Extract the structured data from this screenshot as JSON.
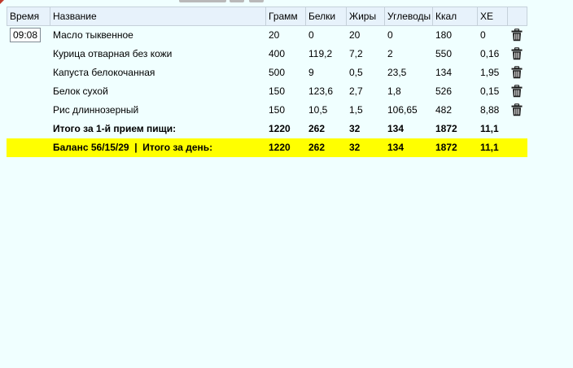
{
  "columns": {
    "time": "Время",
    "name": "Название",
    "grams": "Грамм",
    "protein": "Белки",
    "fat": "Жиры",
    "carbs": "Углеводы",
    "kcal": "Ккал",
    "xe": "ХЕ"
  },
  "rows": [
    {
      "time": "09:08",
      "name": "Масло тыквенное",
      "grams": "20",
      "protein": "0",
      "fat": "20",
      "carbs": "0",
      "kcal": "180",
      "xe": "0",
      "icon": "trash-icon"
    },
    {
      "time": "",
      "name": "Курица отварная без кожи",
      "grams": "400",
      "protein": "119,2",
      "fat": "7,2",
      "carbs": "2",
      "kcal": "550",
      "xe": "0,16",
      "icon": "trash-icon"
    },
    {
      "time": "",
      "name": "Капуста белокочанная",
      "grams": "500",
      "protein": "9",
      "fat": "0,5",
      "carbs": "23,5",
      "kcal": "134",
      "xe": "1,95",
      "icon": "trash-icon"
    },
    {
      "time": "",
      "name": "Белок сухой",
      "grams": "150",
      "protein": "123,6",
      "fat": "2,7",
      "carbs": "1,8",
      "kcal": "526",
      "xe": "0,15",
      "icon": "trash-icon"
    },
    {
      "time": "",
      "name": "Рис длиннозерный",
      "grams": "150",
      "protein": "10,5",
      "fat": "1,5",
      "carbs": "106,65",
      "kcal": "482",
      "xe": "8,88",
      "icon": "trash-icon"
    }
  ],
  "subtotal": {
    "label": "Итого за 1-й прием пищи:",
    "grams": "1220",
    "protein": "262",
    "fat": "32",
    "carbs": "134",
    "kcal": "1872",
    "xe": "11,1"
  },
  "total": {
    "label": "Баланс 56/15/29  |  Итого за день:",
    "grams": "1220",
    "protein": "262",
    "fat": "32",
    "carbs": "134",
    "kcal": "1872",
    "xe": "11,1"
  },
  "colors": {
    "background": "#f0ffff",
    "header_bg": "#e7f2fb",
    "total_highlight": "#ffff00",
    "icon": "#1a1a1a"
  }
}
